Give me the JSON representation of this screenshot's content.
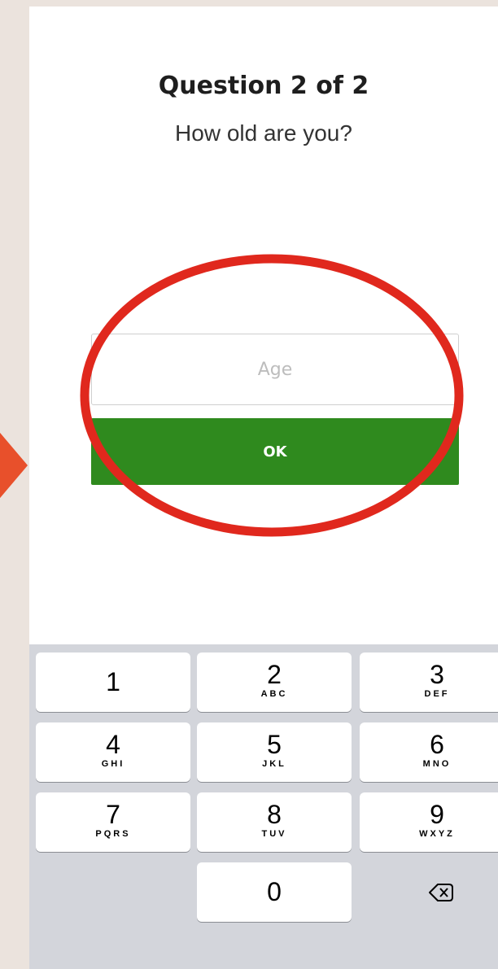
{
  "page": {
    "title": "Question 2 of 2",
    "question": "How old are you?"
  },
  "form": {
    "age_placeholder": "Age",
    "age_value": "",
    "ok_label": "OK"
  },
  "colors": {
    "ok_button": "#2f8a1e",
    "annotation_ellipse": "#e0281d",
    "annotation_arrow": "#e8502b"
  },
  "keypad": {
    "rows": [
      [
        {
          "digit": "1",
          "letters": ""
        },
        {
          "digit": "2",
          "letters": "ABC"
        },
        {
          "digit": "3",
          "letters": "DEF"
        }
      ],
      [
        {
          "digit": "4",
          "letters": "GHI"
        },
        {
          "digit": "5",
          "letters": "JKL"
        },
        {
          "digit": "6",
          "letters": "MNO"
        }
      ],
      [
        {
          "digit": "7",
          "letters": "PQRS"
        },
        {
          "digit": "8",
          "letters": "TUV"
        },
        {
          "digit": "9",
          "letters": "WXYZ"
        }
      ]
    ],
    "zero": "0",
    "delete_icon": "backspace-icon"
  }
}
